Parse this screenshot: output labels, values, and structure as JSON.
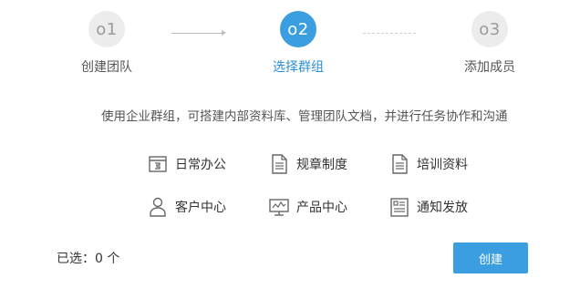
{
  "steps": [
    {
      "number": "o1",
      "label": "创建团队",
      "state": "done"
    },
    {
      "number": "o2",
      "label": "选择群组",
      "state": "active"
    },
    {
      "number": "o3",
      "label": "添加成员",
      "state": "pending"
    }
  ],
  "description": "使用企业群组，可搭建内部资料库、管理团队文档，并进行任务协作和沟通",
  "groups": [
    {
      "label": "日常办公",
      "icon": "calendar-icon"
    },
    {
      "label": "规章制度",
      "icon": "document-icon"
    },
    {
      "label": "培训资料",
      "icon": "document-icon"
    },
    {
      "label": "客户中心",
      "icon": "person-icon"
    },
    {
      "label": "产品中心",
      "icon": "monitor-icon"
    },
    {
      "label": "通知发放",
      "icon": "notice-icon"
    }
  ],
  "footer": {
    "selected_text": "已选：0 个",
    "create_label": "创建"
  },
  "colors": {
    "accent": "#3b9ee0",
    "inactive_circle": "#ececec"
  }
}
